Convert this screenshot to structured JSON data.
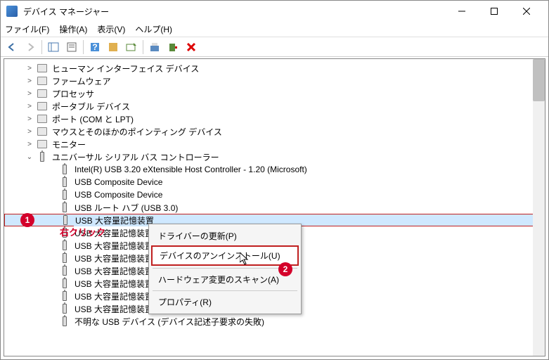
{
  "window": {
    "title": "デバイス マネージャー"
  },
  "menu": {
    "file": "ファイル(F)",
    "action": "操作(A)",
    "view": "表示(V)",
    "help": "ヘルプ(H)"
  },
  "tree": {
    "cats": [
      {
        "label": "ヒューマン インターフェイス デバイス",
        "icon": "hid"
      },
      {
        "label": "ファームウェア",
        "icon": "fw"
      },
      {
        "label": "プロセッサ",
        "icon": "cpu"
      },
      {
        "label": "ポータブル デバイス",
        "icon": "portable"
      },
      {
        "label": "ポート (COM と LPT)",
        "icon": "port"
      },
      {
        "label": "マウスとそのほかのポインティング デバイス",
        "icon": "mouse"
      },
      {
        "label": "モニター",
        "icon": "monitor"
      }
    ],
    "usb_cat": "ユニバーサル シリアル バス コントローラー",
    "usb_children": [
      "Intel(R) USB 3.20 eXtensible Host Controller - 1.20 (Microsoft)",
      "USB Composite Device",
      "USB Composite Device",
      "USB ルート ハブ (USB 3.0)",
      "USB 大容量記憶装置",
      "USB 大容量記憶装置",
      "USB 大容量記憶装置",
      "USB 大容量記憶装置",
      "USB 大容量記憶装置",
      "USB 大容量記憶装置",
      "USB 大容量記憶装置",
      "USB 大容量記憶装置",
      "不明な USB デバイス (デバイス記述子要求の失敗)"
    ],
    "selected_index": 4
  },
  "context": {
    "update": "ドライバーの更新(P)",
    "uninstall": "デバイスのアンインストール(U)",
    "scan": "ハードウェア変更のスキャン(A)",
    "properties": "プロパティ(R)"
  },
  "annotations": {
    "badge1": "1",
    "badge2": "2",
    "right_click": "右クリック"
  }
}
